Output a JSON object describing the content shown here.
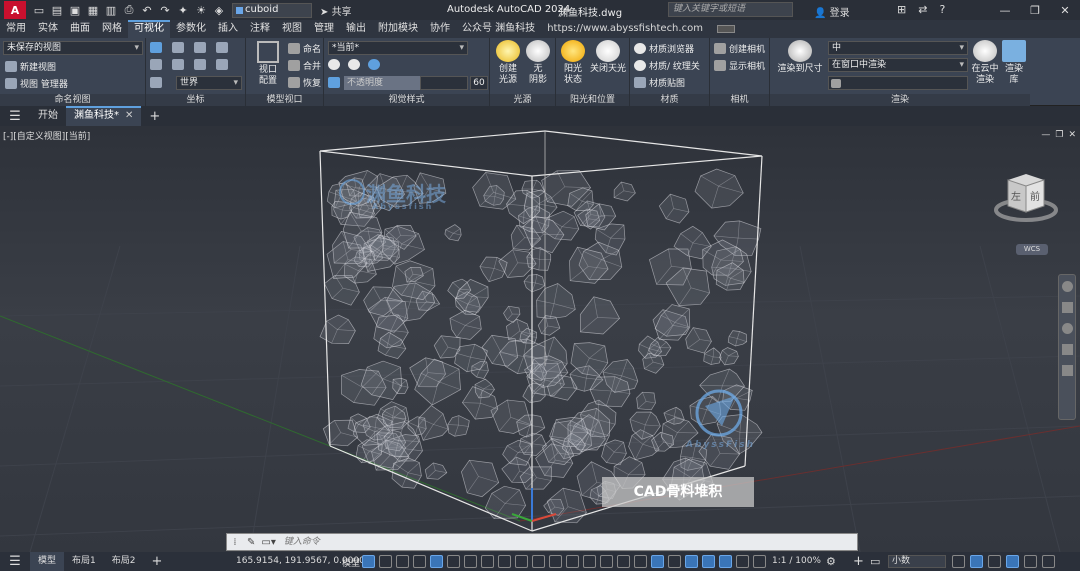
{
  "titlebar": {
    "app_button": "A",
    "workspace_value": "cuboid",
    "share_label": "共享",
    "app_title": "Autodesk AutoCAD 2024",
    "file_title": "渊鱼科技.dwg",
    "search_placeholder": "键入关键字或短语",
    "login_label": "登录"
  },
  "ribbon_tabs": [
    "常用",
    "实体",
    "曲面",
    "网格",
    "可视化",
    "参数化",
    "插入",
    "注释",
    "视图",
    "管理",
    "输出",
    "附加模块",
    "协作",
    "公众号 渊鱼科技",
    "https://www.abyssfishtech.com"
  ],
  "ribbon_tabs_active_index": 4,
  "ribbon": {
    "named_view": {
      "unsaved_view": "未保存的视图",
      "new_view": "新建视图",
      "view_manager": "视图 管理器",
      "label": "命名视图"
    },
    "coords": {
      "world": "世界",
      "label": "坐标"
    },
    "model_viewport": {
      "config_label": "视口\n配置",
      "name": "命名",
      "join": "合并",
      "restore": "恢复",
      "label": "模型视口"
    },
    "visual_style": {
      "current": "*当前*",
      "opacity": "不透明度",
      "opacity_value": "60",
      "label": "视觉样式"
    },
    "lights": {
      "create_light": "创建\n光源",
      "no_shadow": "无\n阴影",
      "label": "光源"
    },
    "sun": {
      "sun_status": "阳光\n状态",
      "close_sky": "关闭天光",
      "label": "阳光和位置"
    },
    "materials": {
      "browser": "材质浏览器",
      "material_texture": "材质/ 纹理关",
      "material_map": "材质贴图",
      "label": "材质"
    },
    "camera": {
      "create_camera": "创建相机",
      "show_camera": "显示相机",
      "label": "相机"
    },
    "render": {
      "render_to_size": "渲染到尺寸",
      "quality": "中",
      "render_in_window": "在窗口中渲染",
      "cloud_render": "在云中\n渲染",
      "render_library": "渲染\n库",
      "label": "渲染"
    }
  },
  "doc_tabs": {
    "start": "开始",
    "active_doc": "渊鱼科技*"
  },
  "viewport": {
    "label": "[-][自定义视图][当前]",
    "viewcube_left": "左",
    "viewcube_front": "前",
    "wcs": "WCS",
    "brand_cn": "渊鱼科技",
    "brand_en": "Abyssfish",
    "brand_en2": "AbyssFish",
    "tag": "CAD骨料堆积"
  },
  "command": {
    "placeholder": "键入命令"
  },
  "statusbar": {
    "tabs": [
      "模型",
      "布局1",
      "布局2"
    ],
    "coords": "165.9154, 191.9567, 0.0000",
    "model": "模型",
    "scale": "1:1 / 100%",
    "units": "小数"
  },
  "colors": {
    "accent": "#5fa0de",
    "app_red": "#c8102e",
    "viewport_bg": "#33373f"
  }
}
